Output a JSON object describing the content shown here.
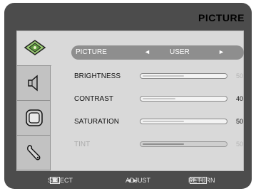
{
  "menu": {
    "title": "PICTURE",
    "tabs": [
      {
        "name": "picture-icon"
      },
      {
        "name": "audio-icon"
      },
      {
        "name": "display-icon"
      },
      {
        "name": "setup-wrench-icon"
      }
    ],
    "picture_mode": {
      "label": "PICTURE",
      "value": "USER",
      "left_arrow": "◄",
      "right_arrow": "►"
    },
    "items": [
      {
        "label": "BRIGHTNESS",
        "value": "50",
        "level": 0.5,
        "enabled": true,
        "value_dim": true
      },
      {
        "label": "CONTRAST",
        "value": "40",
        "level": 0.4,
        "enabled": true,
        "value_dim": false
      },
      {
        "label": "SATURATION",
        "value": "50",
        "level": 0.5,
        "enabled": true,
        "value_dim": false
      },
      {
        "label": "TINT",
        "value": "50",
        "level": 0.5,
        "enabled": false,
        "value_dim": true
      }
    ]
  },
  "footer": {
    "select": "SELECT",
    "adjust": "ADJUST",
    "adjust_arrows": "◄►",
    "return": "RETURN",
    "setup_key": "SETUP"
  },
  "colors": {
    "background": "#4c4c4c",
    "panel": "#d9d9d9",
    "highlight": "#8e8e8e"
  }
}
